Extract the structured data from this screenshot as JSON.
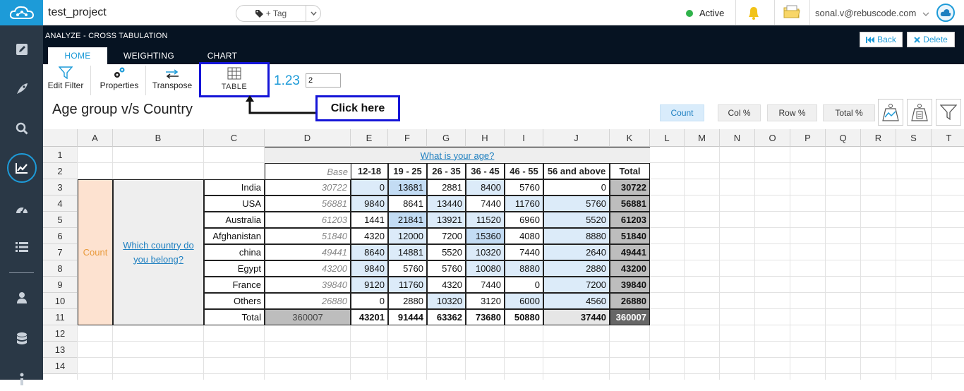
{
  "topbar": {
    "project_name": "test_project",
    "tag_button": "+ Tag",
    "status": "Active",
    "user_email": "sonal.v@rebuscode.com"
  },
  "header": {
    "breadcrumb": "ANALYZE - CROSS TABULATION",
    "tabs": [
      "HOME",
      "WEIGHTING",
      "CHART"
    ],
    "back_label": "Back",
    "delete_label": "Delete"
  },
  "ribbon": {
    "edit_filter": "Edit Filter",
    "properties": "Properties",
    "transpose": "Transpose",
    "table": "TABLE",
    "decimal_label": "1.23",
    "decimal_value": "2"
  },
  "page": {
    "title": "Age group v/s Country",
    "callout": "Click here",
    "view_buttons": [
      "Count",
      "Col %",
      "Row %",
      "Total %"
    ]
  },
  "sheet": {
    "columns": [
      "A",
      "B",
      "C",
      "D",
      "E",
      "F",
      "G",
      "H",
      "I",
      "J",
      "K",
      "L",
      "M",
      "N",
      "O",
      "P",
      "Q",
      "R",
      "S",
      "T"
    ],
    "rows": [
      "1",
      "2",
      "3",
      "4",
      "5",
      "6",
      "7",
      "8",
      "9",
      "10",
      "11",
      "12",
      "13",
      "14"
    ],
    "question_top": "What is your age?",
    "question_side": "Which country do you belong?",
    "stat_label": "Count",
    "base_label": "Base",
    "col_headers": [
      "12-18",
      "19 - 25",
      "26 - 35",
      "36 - 45",
      "46 - 55",
      "56 and above",
      "Total"
    ],
    "data_rows": [
      {
        "label": "India",
        "base": "30722",
        "values": [
          "0",
          "13681",
          "2881",
          "8400",
          "5760",
          "0"
        ],
        "total": "30722"
      },
      {
        "label": "USA",
        "base": "56881",
        "values": [
          "9840",
          "8641",
          "13440",
          "7440",
          "11760",
          "5760"
        ],
        "total": "56881"
      },
      {
        "label": "Australia",
        "base": "61203",
        "values": [
          "1441",
          "21841",
          "13921",
          "11520",
          "6960",
          "5520"
        ],
        "total": "61203"
      },
      {
        "label": "Afghanistan",
        "base": "51840",
        "values": [
          "4320",
          "12000",
          "7200",
          "15360",
          "4080",
          "8880"
        ],
        "total": "51840"
      },
      {
        "label": "china",
        "base": "49441",
        "values": [
          "8640",
          "14881",
          "5520",
          "10320",
          "7440",
          "2640"
        ],
        "total": "49441"
      },
      {
        "label": "Egypt",
        "base": "43200",
        "values": [
          "9840",
          "5760",
          "5760",
          "10080",
          "8880",
          "2880"
        ],
        "total": "43200"
      },
      {
        "label": "France",
        "base": "39840",
        "values": [
          "9120",
          "11760",
          "4320",
          "7440",
          "0",
          "7200"
        ],
        "total": "39840"
      },
      {
        "label": "Others",
        "base": "26880",
        "values": [
          "0",
          "2880",
          "10320",
          "3120",
          "6000",
          "4560"
        ],
        "total": "26880"
      }
    ],
    "total_row": {
      "label": "Total",
      "base": "360007",
      "values": [
        "43201",
        "91444",
        "63362",
        "73680",
        "50880",
        "37440"
      ],
      "total": "360007"
    }
  }
}
